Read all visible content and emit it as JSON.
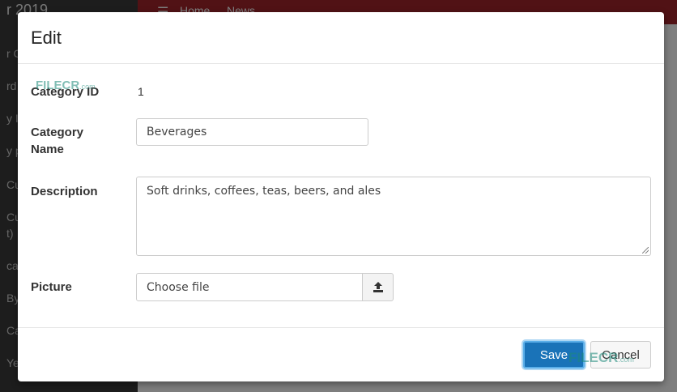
{
  "background": {
    "brand": "r 2019",
    "topnav": {
      "home": "Home",
      "news": "News"
    },
    "sidebar_fragments": [
      "r C",
      "rd",
      "y I",
      "y p",
      "Cu",
      "Cu",
      "t)",
      "ca",
      "By",
      "Ca",
      "Ye"
    ]
  },
  "modal": {
    "title": "Edit",
    "fields": {
      "category_id": {
        "label": "Category ID",
        "value": "1"
      },
      "category_name": {
        "label_line1": "Category",
        "label_line2": "Name",
        "value": "Beverages"
      },
      "description": {
        "label": "Description",
        "value": "Soft drinks, coffees, teas, beers, and ales"
      },
      "picture": {
        "label": "Picture",
        "placeholder": "Choose file",
        "icon": "upload-icon"
      }
    },
    "footer": {
      "save_label": "Save",
      "cancel_label": "Cancel"
    }
  },
  "watermarks": {
    "brand": "FILECR",
    "suffix": ".com"
  },
  "colors": {
    "header": "#a3242b",
    "save": "#1a73b8",
    "watermark": "#1d8a7a"
  }
}
